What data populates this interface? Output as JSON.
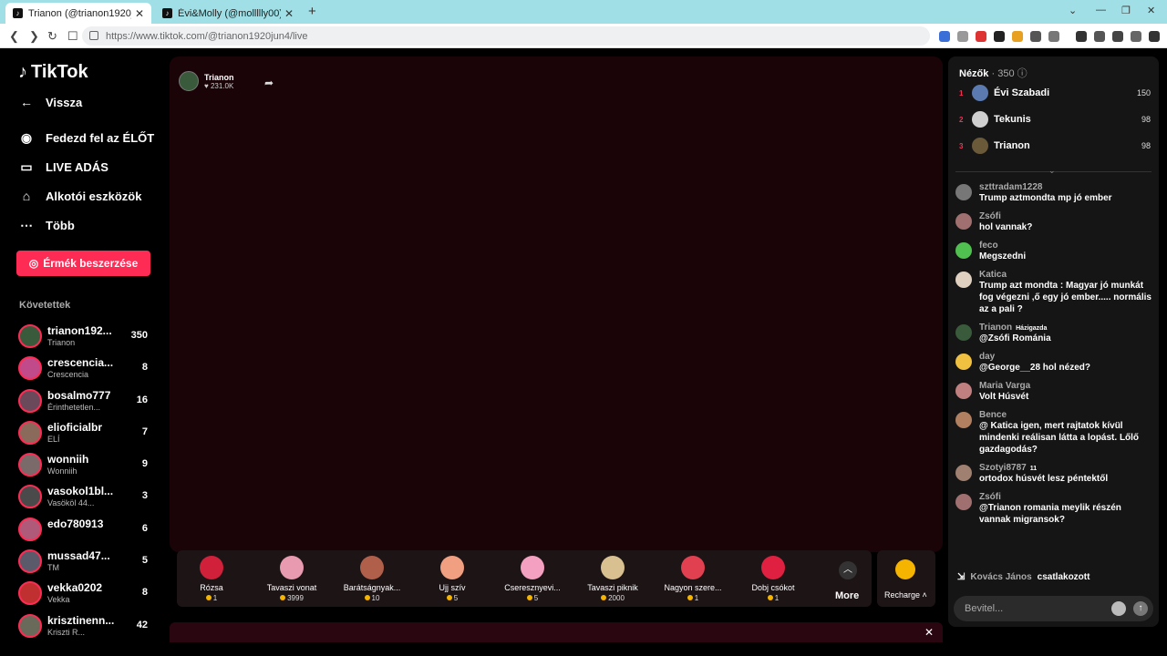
{
  "browser": {
    "tabs": [
      {
        "title": "Trianon (@trianon1920jun4) ÉLŐ"
      },
      {
        "title": "Évi&Molly (@mollllly00) ÉLŐ adásban"
      }
    ],
    "new_tab": "+",
    "url": "https://www.tiktok.com/@trianon1920jun4/live"
  },
  "sidebar": {
    "logo": "TikTok",
    "back": "Vissza",
    "items": [
      {
        "label": "Fedezd fel az ÉLŐT"
      },
      {
        "label": "LIVE ADÁS"
      },
      {
        "label": "Alkotói eszközök"
      },
      {
        "label": "Több"
      }
    ],
    "coins_button": "Érmék beszerzése",
    "following_heading": "Követettek",
    "following": [
      {
        "name": "trianon192...",
        "sub": "Trianon",
        "count": "350",
        "color": "#3a5a3c"
      },
      {
        "name": "crescencia...",
        "sub": "Crescencia",
        "count": "8",
        "color": "#c04a8a"
      },
      {
        "name": "bosalmo777",
        "sub": "Érinthetetlen...",
        "count": "16",
        "color": "#6a4a5a"
      },
      {
        "name": "elioficialbr",
        "sub": "ELÍ",
        "count": "7",
        "color": "#8a6a5a"
      },
      {
        "name": "wonniih",
        "sub": "Wonniih",
        "count": "9",
        "color": "#7a6a6a"
      },
      {
        "name": "vasokol1bl...",
        "sub": "Vasököl 44...",
        "count": "3",
        "color": "#4a4a4a"
      },
      {
        "name": "edo780913",
        "sub": "",
        "count": "6",
        "color": "#b05a7a"
      },
      {
        "name": "mussad47...",
        "sub": "TM",
        "count": "5",
        "color": "#5a5a6a"
      },
      {
        "name": "vekka0202",
        "sub": "Vekka",
        "count": "8",
        "color": "#c03030"
      },
      {
        "name": "krisztinenn...",
        "sub": "Kriszti R...",
        "count": "42",
        "color": "#6a6a5a"
      }
    ]
  },
  "stream": {
    "host_name": "Trianon",
    "host_likes": "231.0K",
    "gifts": [
      {
        "name": "Rózsa",
        "price": "1",
        "color": "#d0203a"
      },
      {
        "name": "Tavaszi vonat",
        "price": "3999",
        "color": "#e89ab0"
      },
      {
        "name": "Barátságnyak...",
        "price": "10",
        "color": "#b0604a"
      },
      {
        "name": "Ujj szív",
        "price": "5",
        "color": "#f0a080"
      },
      {
        "name": "Cseresznyevi...",
        "price": "5",
        "color": "#f4a0c0"
      },
      {
        "name": "Tavaszi piknik",
        "price": "2000",
        "color": "#d8c090"
      },
      {
        "name": "Nagyon szere...",
        "price": "1",
        "color": "#e04050"
      },
      {
        "name": "Dobj csókot",
        "price": "1",
        "color": "#e02040"
      }
    ],
    "more_label": "More",
    "recharge_label": "Recharge"
  },
  "panel": {
    "viewers_label": "Nézők",
    "viewers_count": "350",
    "ranking": [
      {
        "rank": "1",
        "name": "Évi Szabadi",
        "points": "150",
        "color": "#5a7ab0"
      },
      {
        "rank": "2",
        "name": "Tekunis",
        "points": "98",
        "color": "#cfcfcf"
      },
      {
        "rank": "3",
        "name": "Trianon",
        "points": "98",
        "color": "#6a5a3a"
      }
    ],
    "messages": [
      {
        "name": "szttradam1228",
        "badge": "",
        "text": "Trump aztmondta mp jó ember",
        "color": "#777"
      },
      {
        "name": "Zsófi",
        "badge": "",
        "text": "hol vannak?",
        "color": "#a07070"
      },
      {
        "name": "feco",
        "badge": "",
        "text": "Megszedni",
        "color": "#50c050"
      },
      {
        "name": "Katica",
        "badge": "",
        "text": "Trump azt mondta : Magyar jó munkát fog végezni ,ő egy jó ember..... normális az a pali ?",
        "color": "#e0d0c0"
      },
      {
        "name": "Trianon",
        "badge": "Házigazda",
        "text": "@Zsófi Románia",
        "color": "#3a5a3c"
      },
      {
        "name": "day",
        "badge": "",
        "text": "@George__28 hol nézed?",
        "color": "#f0c040"
      },
      {
        "name": "Maria Varga",
        "badge": "",
        "text": "Volt Húsvét",
        "color": "#c08080"
      },
      {
        "name": "Bence",
        "badge": "",
        "text": "@ Katica igen, mert rajtatok kívül mindenki reálisan látta a lopást. Lőlő gazdagodás?",
        "color": "#b08060"
      },
      {
        "name": "Szotyi8787",
        "badge": "11",
        "text": "ortodox húsvét lesz péntektől",
        "color": "#a08070"
      },
      {
        "name": "Zsófi",
        "badge": "",
        "text": "@Trianon romania meylik részén vannak migransok?",
        "color": "#a07070"
      }
    ],
    "joined_name": "Kovács János",
    "joined_text": "csatlakozott",
    "input_placeholder": "Bevitel..."
  }
}
